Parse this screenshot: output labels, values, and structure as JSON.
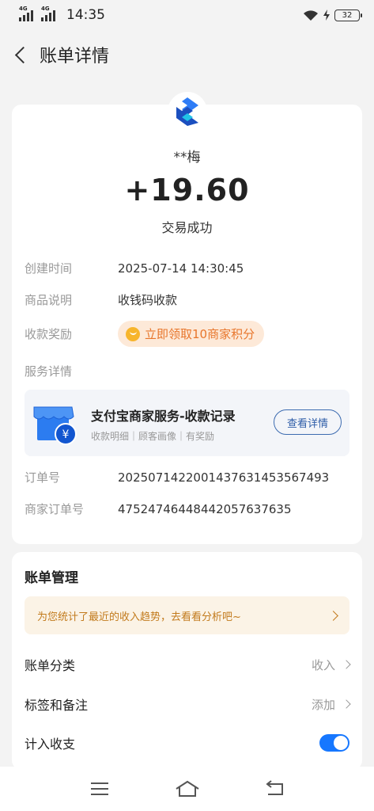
{
  "status_bar": {
    "net1": "4G",
    "net2": "4G",
    "time": "14:35",
    "battery": "32"
  },
  "header": {
    "title": "账单详情"
  },
  "transaction": {
    "payer": "**梅",
    "amount": "+19.60",
    "status": "交易成功"
  },
  "details": {
    "created_label": "创建时间",
    "created_value": "2025-07-14 14:30:45",
    "desc_label": "商品说明",
    "desc_value": "收钱码收款",
    "reward_label": "收款奖励",
    "reward_value": "立即领取10商家积分",
    "service_label": "服务详情"
  },
  "service_card": {
    "title": "支付宝商家服务-收款记录",
    "subtitle": "收款明细｜顾客画像｜有奖励",
    "button": "查看详情"
  },
  "orders": {
    "order_label": "订单号",
    "order_value": "20250714220014376314535674​93",
    "merchant_label": "商家订单号",
    "merchant_value": "47524746448442057637635"
  },
  "management": {
    "title": "账单管理",
    "tip": "为您统计了最近的收入趋势，去看看分析吧~",
    "category_label": "账单分类",
    "category_value": "收入",
    "tags_label": "标签和备注",
    "tags_value": "添加",
    "include_label": "计入收支",
    "include_on": true
  },
  "colors": {
    "accent": "#1677ff",
    "reward_text": "#e8762c",
    "tip_text": "#c27a1c"
  }
}
